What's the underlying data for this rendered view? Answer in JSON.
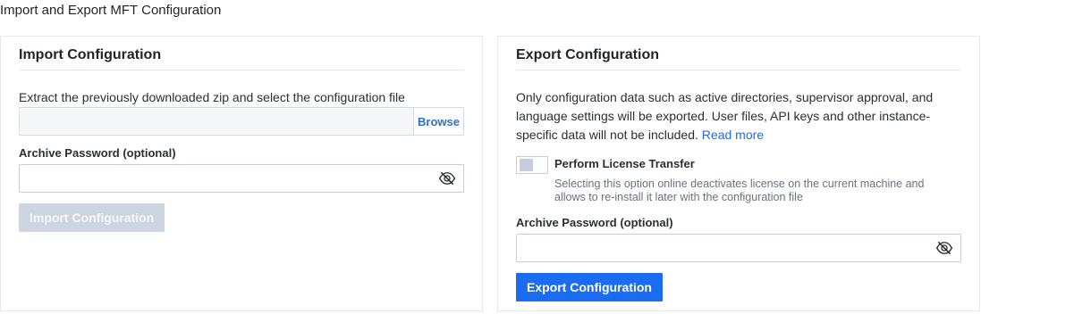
{
  "page": {
    "title": "Import and Export MFT Configuration"
  },
  "import": {
    "title": "Import Configuration",
    "description": "Extract the previously downloaded zip and select the configuration file",
    "file_value": "",
    "browse_label": "Browse",
    "password_label": "Archive Password (optional)",
    "password_value": "",
    "submit_label": "Import Configuration",
    "submit_state": "disabled"
  },
  "export": {
    "title": "Export Configuration",
    "description_lines": [
      "Only configuration data such as active directories, supervisor approval, and",
      "language settings will be exported. User files, API keys and other instance-",
      "specific data will not be included."
    ],
    "read_more": "Read more",
    "license_toggle": {
      "label": "Perform License Transfer",
      "checked": false,
      "hint_lines": [
        "Selecting this option online deactivates license on the current machine and",
        "allows to re-install it later with the configuration file"
      ]
    },
    "password_label": "Archive Password (optional)",
    "password_value": "",
    "submit_label": "Export Configuration"
  },
  "icons": {
    "password_visibility": "eye-slash-icon"
  },
  "colors": {
    "primary": "#1a6cf0",
    "disabled": "#cdd5e2",
    "link": "#1a6cf0"
  }
}
